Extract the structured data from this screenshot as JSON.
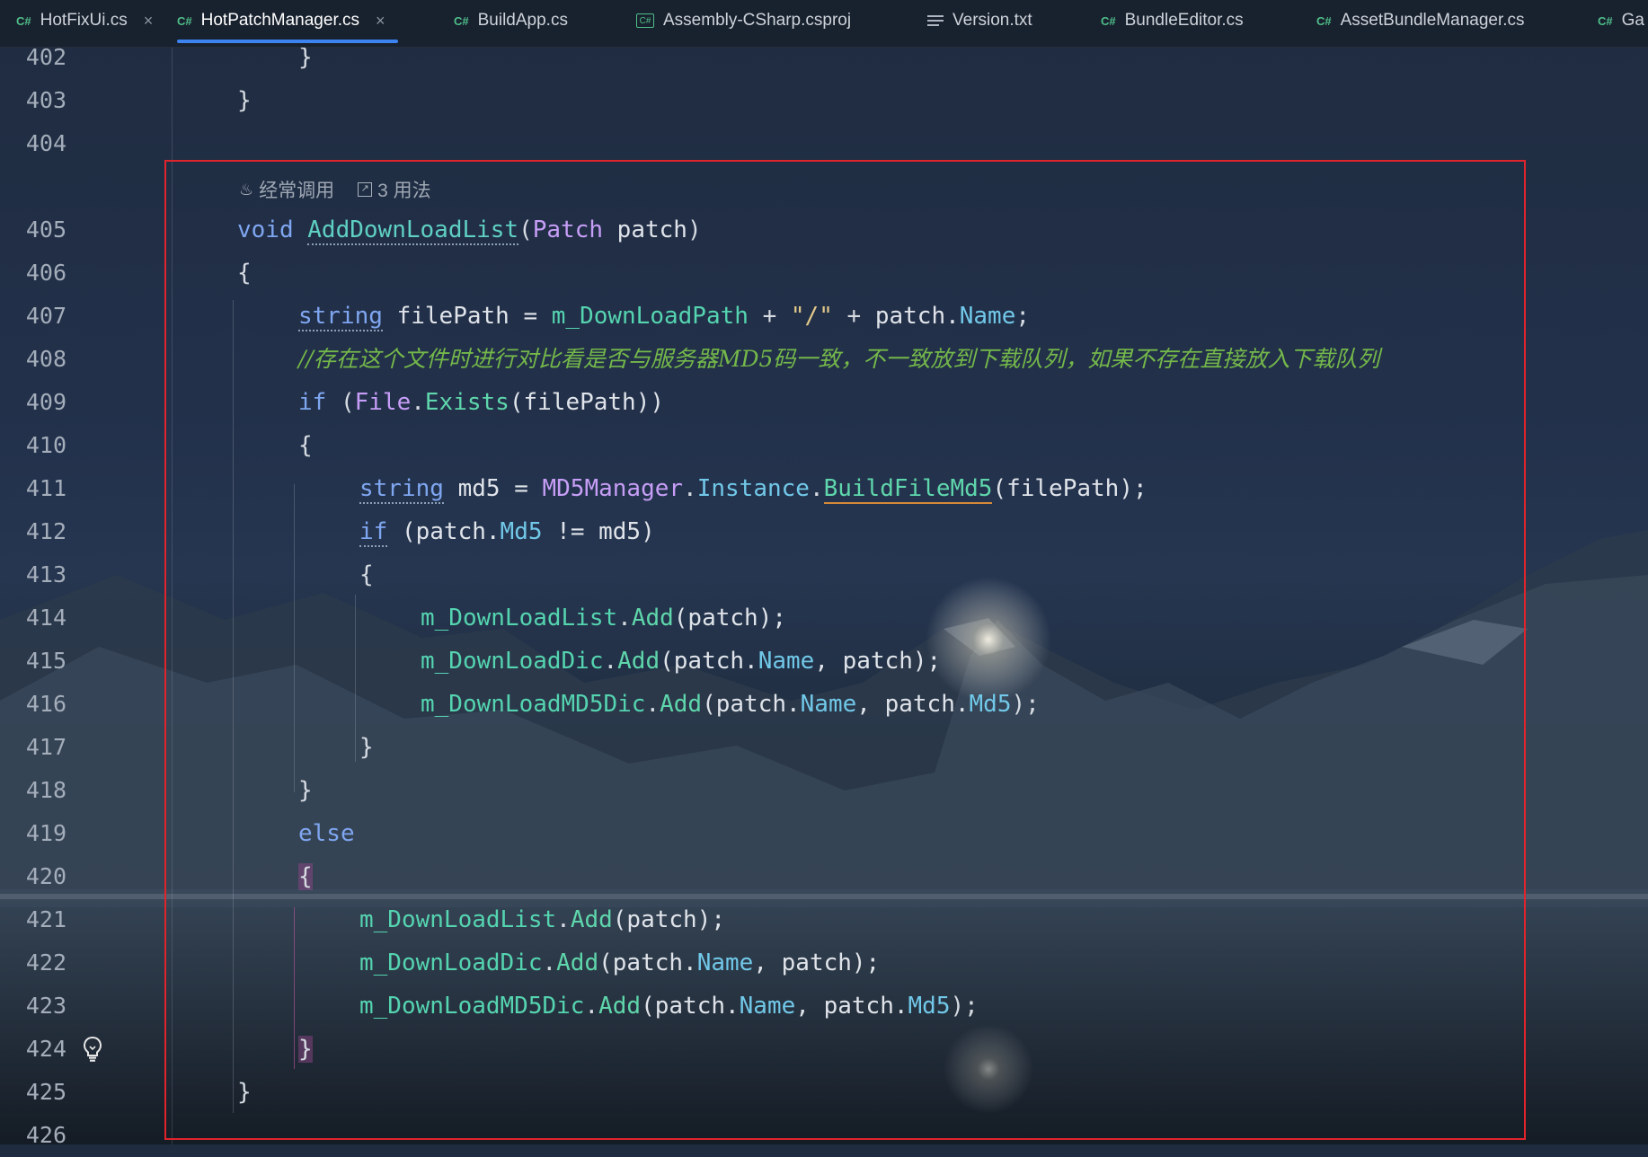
{
  "tabs": [
    {
      "label": "HotFixUi.cs",
      "icon": "csharp-file-icon",
      "active": false,
      "closable": true
    },
    {
      "label": "HotPatchManager.cs",
      "icon": "csharp-file-icon",
      "active": true,
      "closable": true
    },
    {
      "label": "BuildApp.cs",
      "icon": "csharp-file-icon",
      "active": false
    },
    {
      "label": "Assembly-CSharp.csproj",
      "icon": "csproj-file-icon",
      "active": false
    },
    {
      "label": "Version.txt",
      "icon": "text-file-icon",
      "active": false
    },
    {
      "label": "BundleEditor.cs",
      "icon": "csharp-file-icon",
      "active": false
    },
    {
      "label": "AssetBundleManager.cs",
      "icon": "csharp-file-icon",
      "active": false
    },
    {
      "label": "Ga",
      "icon": "csharp-file-icon",
      "active": false
    }
  ],
  "icon_glyphs": {
    "csharp": "C#",
    "csproj": "C#",
    "close": "×",
    "fire": "♨",
    "usages": "↗",
    "bulb": "💡"
  },
  "code_hint": {
    "frequent": "经常调用",
    "usages": "3 用法"
  },
  "line_numbers": [
    "402",
    "403",
    "404",
    "405",
    "406",
    "407",
    "408",
    "409",
    "410",
    "411",
    "412",
    "413",
    "414",
    "415",
    "416",
    "417",
    "418",
    "419",
    "420",
    "421",
    "422",
    "423",
    "424",
    "425",
    "426"
  ],
  "tokens": {
    "rbrace": "}",
    "lbrace": "{",
    "void": "void",
    "AddDownLoadList": "AddDownLoadList",
    "lparen": "(",
    "rparen": ")",
    "Patch": "Patch",
    "patch_param": " patch",
    "string": "string",
    "filePath_decl": " filePath = ",
    "m_DownLoadPath": "m_DownLoadPath",
    "plus": " + ",
    "slash_str": "\"/\"",
    "patch_dot": "patch.",
    "Name": "Name",
    "semicolon": ";",
    "comment": "//存在这个文件时进行对比看是否与服务器MD5码一致，不一致放到下载队列，如果不存在直接放入下载队列",
    "if": "if",
    "if_open": " (",
    "File": "File",
    "dot": ".",
    "Exists": "Exists",
    "filePath_call": "(filePath))",
    "md5_decl": " md5 = ",
    "MD5Manager": "MD5Manager",
    "Instance": "Instance",
    "BuildFileMd5": "BuildFileMd5",
    "filePath_end": "(filePath);",
    "patch_open": " (patch.",
    "Md5": "Md5",
    "neq_md5": " != md5)",
    "m_DownLoadList": "m_DownLoadList",
    "m_DownLoadDic": "m_DownLoadDic",
    "m_DownLoadMD5Dic": "m_DownLoadMD5Dic",
    "Add": "Add",
    "patch_call_end": "(patch);",
    "open_patch_dot": "(patch.",
    "comma_patch_end": ", patch);",
    "comma_patch_dot": ", patch.",
    "close_end": ");",
    "else": "else"
  }
}
